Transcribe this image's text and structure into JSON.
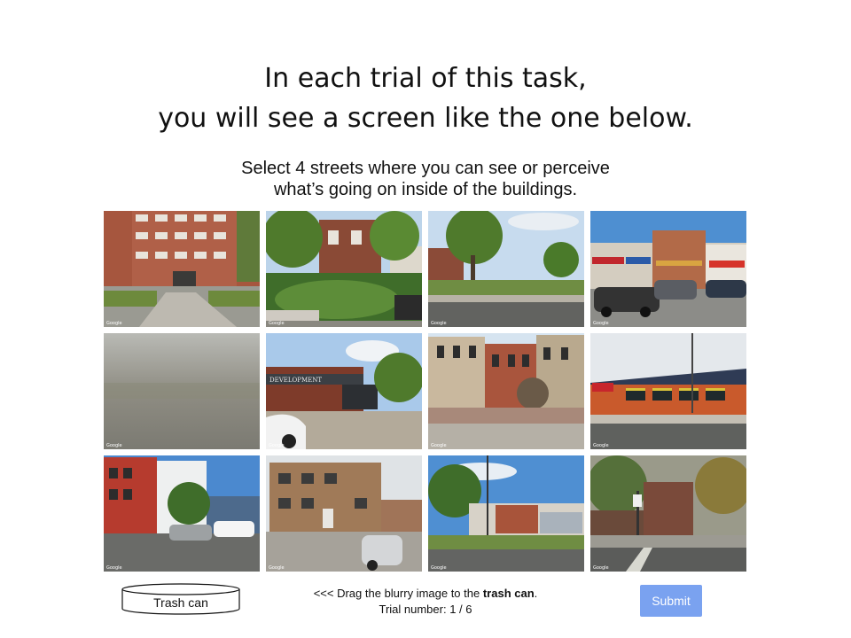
{
  "title": {
    "line1": "In each trial of this task,",
    "line2": "you will see a screen like the one below."
  },
  "instructions": {
    "line1": "Select 4 streets where you can see or perceive",
    "line2": "what’s going on inside of the buildings."
  },
  "images": [
    {
      "name": "street-image-brick-apartment",
      "watermark": "Google"
    },
    {
      "name": "street-image-garden-house",
      "watermark": "Google"
    },
    {
      "name": "street-image-tree-lot",
      "watermark": "Google"
    },
    {
      "name": "street-image-storefronts",
      "watermark": "Google"
    },
    {
      "name": "street-image-blurry",
      "watermark": "Google"
    },
    {
      "name": "street-image-development-building",
      "watermark": "Google"
    },
    {
      "name": "street-image-rowhouses",
      "watermark": "Google"
    },
    {
      "name": "street-image-solar-roof-store",
      "watermark": "Google"
    },
    {
      "name": "street-image-modern-condo",
      "watermark": "Google"
    },
    {
      "name": "street-image-alley-brick",
      "watermark": "Google"
    },
    {
      "name": "street-image-corner-store",
      "watermark": "Google"
    },
    {
      "name": "street-image-tree-block",
      "watermark": "Google"
    }
  ],
  "trash_can": {
    "label": "Trash can"
  },
  "drag_hint": {
    "prefix": "<<< Drag the blurry image to the ",
    "bold": "trash can",
    "suffix": ".",
    "trial_line": "Trial number: 1 / 6"
  },
  "submit": {
    "label": "Submit",
    "color": "#7aa2f0"
  }
}
